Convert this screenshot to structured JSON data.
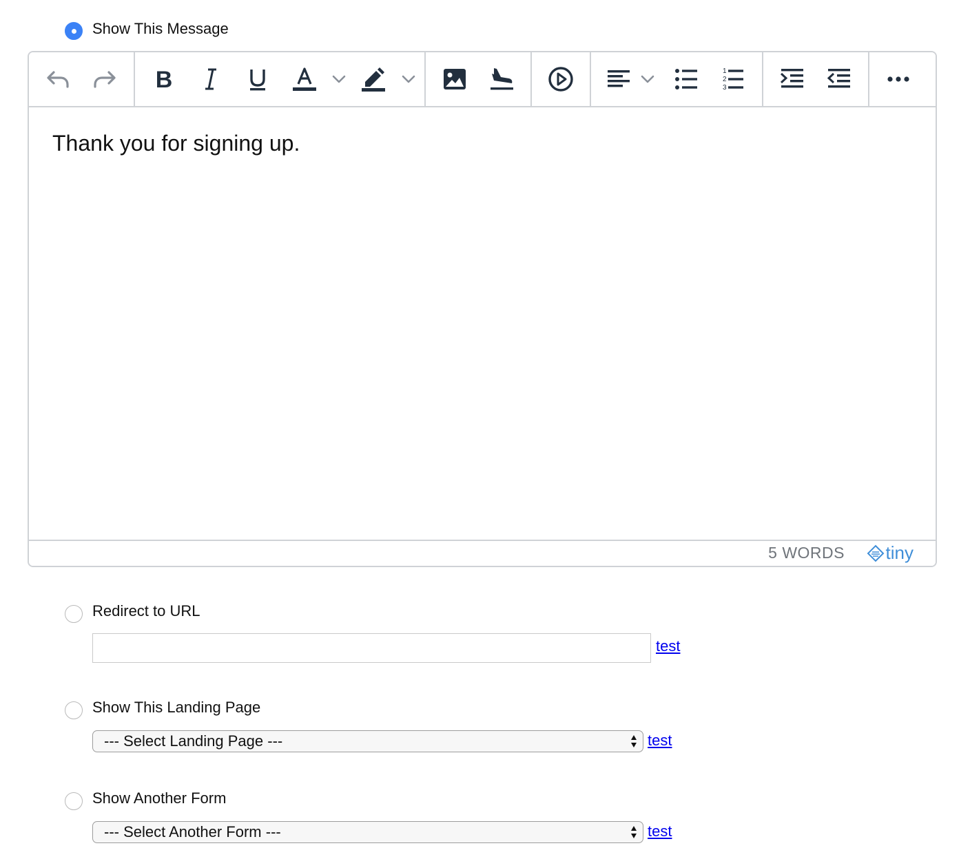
{
  "options": {
    "show_message": {
      "label": "Show This Message",
      "checked": true
    },
    "redirect_url": {
      "label": "Redirect to URL",
      "checked": false,
      "input_value": "",
      "test_link": "test"
    },
    "landing_page": {
      "label": "Show This Landing Page",
      "checked": false,
      "selected": "--- Select Landing Page ---",
      "test_link": "test"
    },
    "another_form": {
      "label": "Show Another Form",
      "checked": false,
      "selected": "--- Select Another Form ---",
      "test_link": "test"
    }
  },
  "editor": {
    "toolbar": [
      [
        "undo-icon",
        "redo-icon"
      ],
      [
        "bold-icon",
        "italic-icon",
        "underline-icon",
        "text-color-icon",
        "highlight-color-icon"
      ],
      [
        "image-icon",
        "landing-plane-icon"
      ],
      [
        "media-play-icon"
      ],
      [
        "align-left-icon",
        "bullet-list-icon",
        "numbered-list-icon"
      ],
      [
        "indent-icon",
        "outdent-icon"
      ],
      [
        "more-icon"
      ]
    ],
    "content": "Thank you for signing up.",
    "word_count": "5 WORDS",
    "brand": "tiny"
  },
  "colors": {
    "radio_checked": "#3b82f6",
    "link": "#0000ee",
    "tiny_brand": "#3f8ed8",
    "icon": "#222f3e"
  }
}
